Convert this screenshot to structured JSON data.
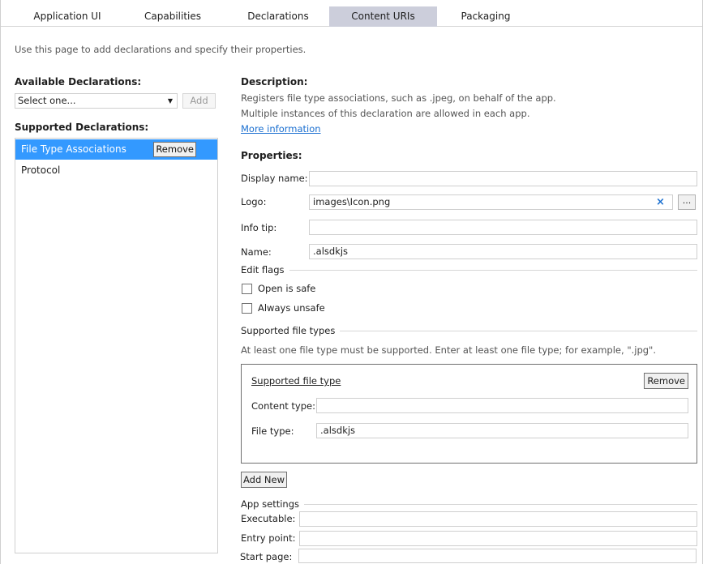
{
  "tabs": [
    {
      "label": "Application UI"
    },
    {
      "label": "Capabilities"
    },
    {
      "label": "Declarations"
    },
    {
      "label": "Content URIs"
    },
    {
      "label": "Packaging"
    }
  ],
  "intro": "Use this page to add declarations and specify their properties.",
  "left": {
    "available_label": "Available Declarations:",
    "select_value": "Select one...",
    "add_label": "Add",
    "supported_label": "Supported Declarations:",
    "items": [
      {
        "label": "File Type Associations",
        "remove_label": "Remove"
      },
      {
        "label": "Protocol"
      }
    ]
  },
  "right": {
    "description_label": "Description:",
    "description_line1": "Registers file type associations, such as .jpeg, on behalf of the app.",
    "description_line2": "Multiple instances of this declaration are allowed in each app.",
    "more_info": "More information",
    "properties_label": "Properties:",
    "display_name_label": "Display name:",
    "display_name_value": "",
    "logo_label": "Logo:",
    "logo_value": "images\\Icon.png",
    "clear_glyph": "×",
    "browse_label": "...",
    "info_tip_label": "Info tip:",
    "info_tip_value": "",
    "name_label": "Name:",
    "name_value": ".alsdkjs",
    "edit_flags_label": "Edit flags",
    "open_is_safe_label": "Open is safe",
    "always_unsafe_label": "Always unsafe",
    "supported_types_label": "Supported file types",
    "supported_types_hint": "At least one file type must be supported. Enter at least one file type; for example, \".jpg\".",
    "sft": {
      "title": "Supported file type",
      "remove_label": "Remove",
      "content_type_label": "Content type:",
      "content_type_value": "",
      "file_type_label": "File type:",
      "file_type_value": ".alsdkjs"
    },
    "add_new_label": "Add New",
    "app_settings_label": "App settings",
    "executable_label": "Executable:",
    "executable_value": "",
    "entry_point_label": "Entry point:",
    "entry_point_value": "",
    "start_page_label": "Start page:",
    "start_page_value": ""
  },
  "colors": {
    "active_tab": "#cccedb",
    "selected_item": "#3399ff",
    "link": "#1a6fd0"
  }
}
